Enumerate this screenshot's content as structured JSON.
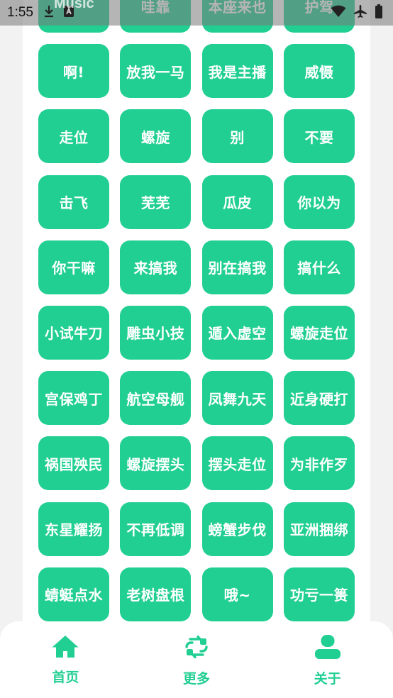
{
  "status_bar": {
    "time": "1:55",
    "app_peek": "Music",
    "icons": [
      "download-icon",
      "notification-a-icon",
      "wifi-icon",
      "airplane-icon",
      "battery-icon"
    ]
  },
  "colors": {
    "accent": "#22cf93",
    "background": "#f1f2f1",
    "panel": "#ffffff"
  },
  "sound_buttons": [
    [
      "",
      "哇靠",
      "本座来也",
      "护驾"
    ],
    [
      "啊!",
      "放我一马",
      "我是主播",
      "威慑"
    ],
    [
      "走位",
      "螺旋",
      "别",
      "不要"
    ],
    [
      "击飞",
      "芜芜",
      "瓜皮",
      "你以为"
    ],
    [
      "你干嘛",
      "来搞我",
      "别在搞我",
      "搞什么"
    ],
    [
      "小试牛刀",
      "雕虫小技",
      "遁入虚空",
      "螺旋走位"
    ],
    [
      "宫保鸡丁",
      "航空母舰",
      "凤舞九天",
      "近身硬打"
    ],
    [
      "祸国殃民",
      "螺旋摆头",
      "摆头走位",
      "为非作歹"
    ],
    [
      "东星耀扬",
      "不再低调",
      "螃蟹步伐",
      "亚洲捆绑"
    ],
    [
      "蜻蜓点水",
      "老树盘根",
      "哦~",
      "功亏一篑"
    ]
  ],
  "bottom_nav": [
    {
      "label": "首页",
      "icon": "home-icon"
    },
    {
      "label": "更多",
      "icon": "refresh-swap-icon"
    },
    {
      "label": "关于",
      "icon": "user-icon"
    }
  ]
}
